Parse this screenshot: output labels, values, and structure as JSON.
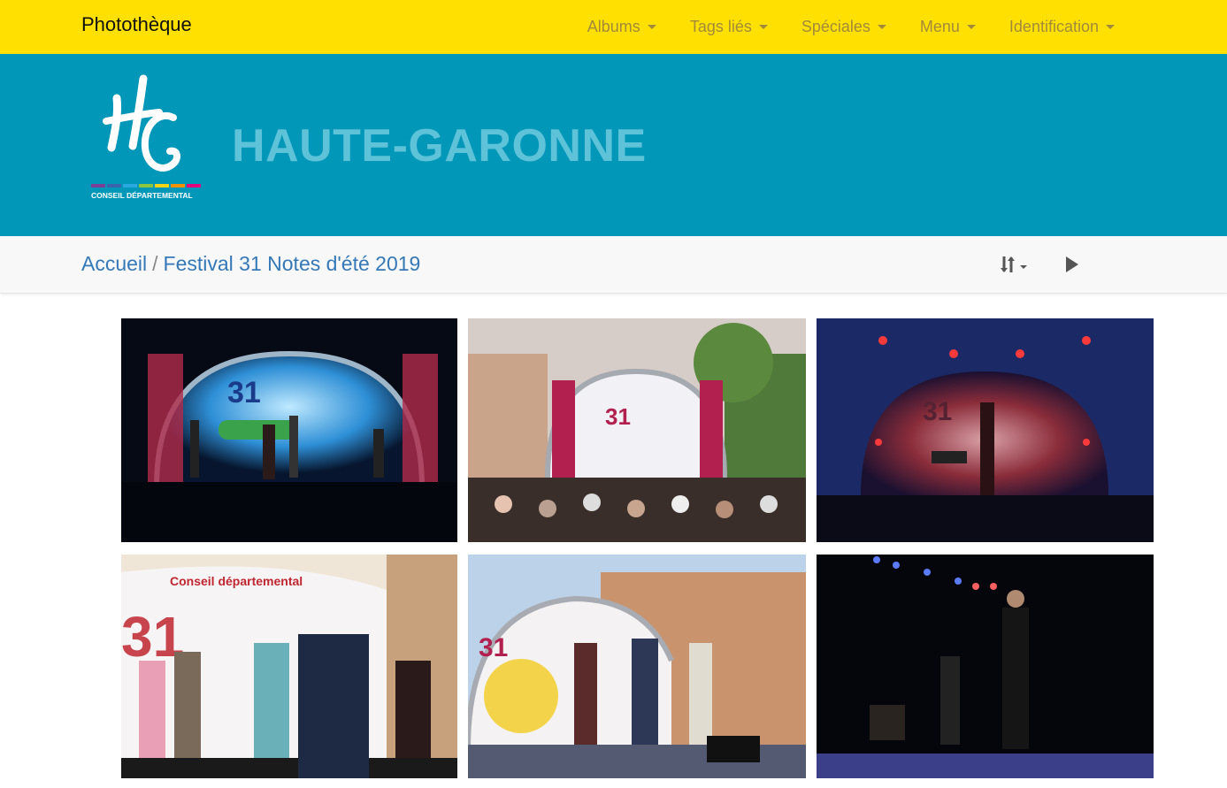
{
  "navbar": {
    "brand": "Photothèque",
    "items": [
      {
        "label": "Albums"
      },
      {
        "label": "Tags liés"
      },
      {
        "label": "Spéciales"
      },
      {
        "label": "Menu"
      },
      {
        "label": "Identification"
      }
    ]
  },
  "banner": {
    "title": "HAUTE-GARONNE",
    "logo_text": "CONSEIL DÉPARTEMENTAL",
    "logo_mark": "HG"
  },
  "breadcrumb": {
    "home": "Accueil",
    "separator": "/",
    "current": "Festival 31 Notes d'été 2019"
  },
  "toolbar": {
    "sort_icon": "sort-icon",
    "slideshow_icon": "play-icon"
  },
  "colors": {
    "navbar_bg": "#ffe000",
    "banner_bg": "#0097b8",
    "link": "#3578b8"
  },
  "photos": [
    {
      "name": "photo-concert-blue-stage"
    },
    {
      "name": "photo-concert-outdoor-crowd"
    },
    {
      "name": "photo-concert-red-stage"
    },
    {
      "name": "photo-children-performance"
    },
    {
      "name": "photo-speakers-on-stage"
    },
    {
      "name": "photo-flamenco-dancers"
    }
  ]
}
